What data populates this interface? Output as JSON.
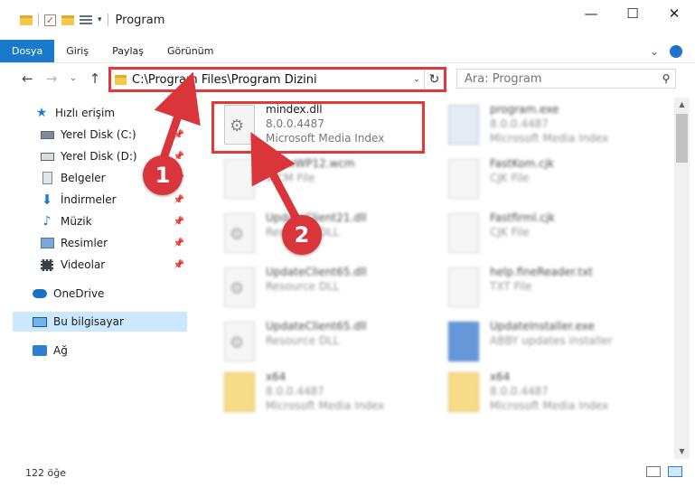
{
  "window": {
    "title": "Program",
    "controls": {
      "minimize": "—",
      "maximize": "☐",
      "close": "✕"
    }
  },
  "ribbon": {
    "tabs": [
      "Dosya",
      "Giriş",
      "Paylaş",
      "Görünüm"
    ],
    "expand": "⌄",
    "help": "?"
  },
  "nav": {
    "back": "←",
    "forward": "→",
    "recent": "⌄",
    "up": "↑"
  },
  "address": {
    "path": "C:\\Program Files\\Program Dizini",
    "dropdown": "⌄",
    "refresh": "↻"
  },
  "search": {
    "placeholder": "Ara: Program",
    "icon": "⚲"
  },
  "sidebar": {
    "items": [
      {
        "label": "Hızlı erişim",
        "icon": "star-icon"
      },
      {
        "label": "Yerel Disk (C:)",
        "icon": "drive-icon",
        "pinned": true
      },
      {
        "label": "Yerel Disk (D:)",
        "icon": "drive-icon",
        "pinned": true
      },
      {
        "label": "Belgeler",
        "icon": "documents-icon",
        "pinned": true
      },
      {
        "label": "İndirmeler",
        "icon": "download-icon",
        "pinned": true
      },
      {
        "label": "Müzik",
        "icon": "music-icon",
        "pinned": true
      },
      {
        "label": "Resimler",
        "icon": "pictures-icon",
        "pinned": true
      },
      {
        "label": "Videolar",
        "icon": "videos-icon",
        "pinned": true
      },
      {
        "label": "OneDrive",
        "icon": "cloud-icon"
      },
      {
        "label": "Bu bilgisayar",
        "icon": "computer-icon",
        "active": true
      },
      {
        "label": "Ağ",
        "icon": "network-icon"
      }
    ],
    "pin_glyph": "📌"
  },
  "files": [
    {
      "name": "mindex.dll",
      "version": "8.0.0.4487",
      "desc": "Microsoft Media Index",
      "highlighted": true
    },
    {
      "name": "program.exe",
      "version": "8.0.0.4487",
      "desc": "Microsoft Media Index"
    },
    {
      "name": "SnowWP12.wcm",
      "version": "",
      "desc": "WCM File"
    },
    {
      "name": "FastKom.cjk",
      "version": "",
      "desc": "CJK File"
    },
    {
      "name": "UpdateClient21.dll",
      "version": "",
      "desc": "Resource DLL"
    },
    {
      "name": "Fastfirml.cjk",
      "version": "",
      "desc": "CJK File"
    },
    {
      "name": "UpdateClient65.dll",
      "version": "",
      "desc": "Resource DLL"
    },
    {
      "name": "help.fineReader.txt",
      "version": "",
      "desc": "TXT File"
    },
    {
      "name": "UpdateClient65.dll",
      "version": "",
      "desc": "Resource DLL"
    },
    {
      "name": "UpdateInstaller.exe",
      "version": "",
      "desc": "ABBY updates installer"
    },
    {
      "name": "x64",
      "version": "8.0.0.4487",
      "desc": "Microsoft Media Index"
    },
    {
      "name": "x64",
      "version": "8.0.0.4487",
      "desc": "Microsoft Media Index"
    }
  ],
  "status": {
    "count": "122 öğe"
  },
  "annotations": {
    "markers": [
      "1",
      "2"
    ],
    "color": "#d9353a"
  },
  "colors": {
    "accent": "#1979ca",
    "highlight": "#e2383a",
    "selection": "#cce8ff"
  }
}
